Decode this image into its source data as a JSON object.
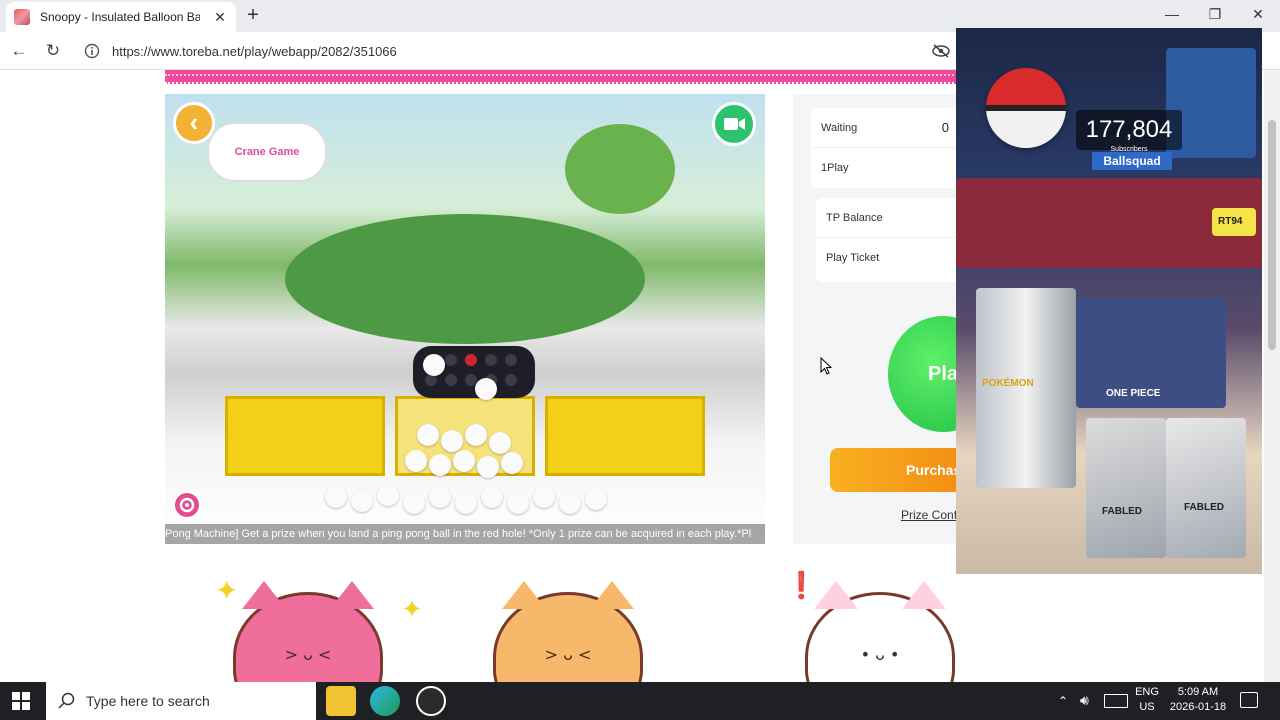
{
  "browser": {
    "tab_title": "Snoopy - Insulated Balloon Bag S",
    "tab_close": "✕",
    "new_tab": "+",
    "url": "https://www.toreba.net/play/webapp/2082/351066",
    "window_controls": {
      "minimize": "—",
      "maximize": "❐",
      "close": "✕"
    },
    "nav": {
      "back": "←",
      "reload": "↻"
    }
  },
  "stream": {
    "logo_text": "Crane Game",
    "back_glyph": "‹",
    "ticker": "Pong Machine] Get a prize when you land a ping pong ball in the red hole! *Only 1 prize can be acquired in each play.*Pl"
  },
  "panel": {
    "waiting_label": "Waiting",
    "waiting_value": "0",
    "one_play_label": "1Play",
    "tp_balance_label": "TP Balance",
    "play_ticket_label": "Play Ticket",
    "play_button": "Pla",
    "purchase_button": "Purchas",
    "prize_link": "Prize Confi"
  },
  "overlay": {
    "sub_count": "177,804",
    "sub_small": "Subscribers",
    "channel": "Ballsquad",
    "pack_left": "POKÉMON",
    "pack_center": "ONE PIECE",
    "fabled_1": "FABLED",
    "fabled_2": "FABLED",
    "sticky": "RT94"
  },
  "taskbar": {
    "search_placeholder": "Type here to search",
    "lang_top": "ENG",
    "lang_bottom": "US",
    "time": "5:09 AM",
    "date": "2026-01-18"
  },
  "icons": [
    "windows-icon",
    "search-icon",
    "file-explorer-icon",
    "edge-icon",
    "obs-icon",
    "camera-icon",
    "settings-icon",
    "back-arrow-icon",
    "notification-icon",
    "volume-icon",
    "keyboard-icon",
    "chevron-up-icon"
  ]
}
